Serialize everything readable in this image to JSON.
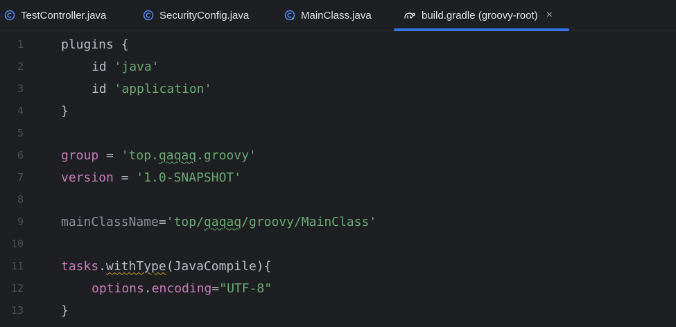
{
  "tabs": [
    {
      "label": "TestController.java",
      "icon": "java-class-icon"
    },
    {
      "label": "SecurityConfig.java",
      "icon": "java-class-icon"
    },
    {
      "label": "MainClass.java",
      "icon": "java-main-class-icon"
    },
    {
      "label": "build.gradle (groovy-root)",
      "icon": "gradle-icon",
      "active": true,
      "close": "×"
    }
  ],
  "code": {
    "line_numbers": [
      "1",
      "2",
      "3",
      "4",
      "5",
      "6",
      "7",
      "8",
      "9",
      "10",
      "11",
      "12",
      "13"
    ],
    "l1": {
      "kw": "plugins",
      "rest": " {"
    },
    "l2": {
      "kw": "id",
      "str": "'java'"
    },
    "l3": {
      "kw": "id",
      "str": "'application'"
    },
    "l4": {
      "text": "}"
    },
    "l6": {
      "kw": "group",
      "eq": " = ",
      "s1": "'top.",
      "typo": "qaqaq",
      "s2": ".groovy'"
    },
    "l7": {
      "kw": "version",
      "eq": " = ",
      "str": "'1.0-SNAPSHOT'"
    },
    "l9": {
      "name": "mainClassName",
      "eq": "=",
      "s1": "'top/",
      "typo": "qaqaq",
      "s2": "/groovy/MainClass'"
    },
    "l11": {
      "kw": "tasks",
      "dot": ".",
      "method": "withType",
      "rest": "(JavaCompile){"
    },
    "l12": {
      "kw1": "options",
      "dot": ".",
      "kw2": "encoding",
      "eq": "=",
      "str": "\"UTF-8\""
    },
    "l13": {
      "text": "}"
    }
  },
  "colors": {
    "accent": "#3574f0",
    "keyword": "#c77dbb",
    "string": "#6aab73",
    "background": "#1e1f22"
  }
}
